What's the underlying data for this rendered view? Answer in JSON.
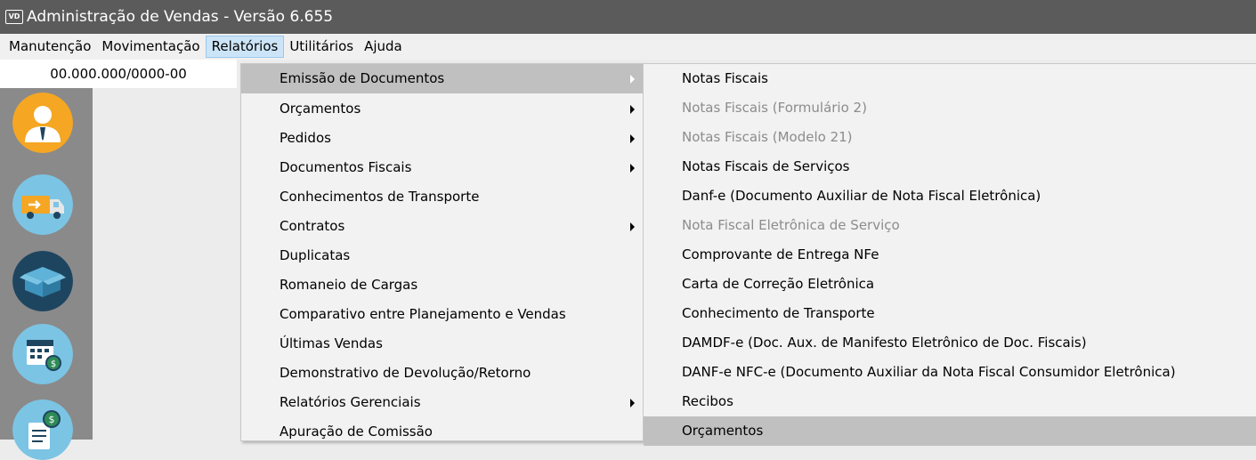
{
  "window": {
    "app_icon": "VD",
    "title": "Administração de Vendas - Versão 6.655"
  },
  "menubar": [
    {
      "label": "Manutenção"
    },
    {
      "label": "Movimentação"
    },
    {
      "label": "Relatórios",
      "active": true
    },
    {
      "label": "Utilitários"
    },
    {
      "label": "Ajuda"
    }
  ],
  "cnpj": "00.000.000/0000-00",
  "sidebar_icons": [
    "user-icon",
    "truck-icon",
    "box-icon",
    "calendar-money-icon",
    "document-money-icon"
  ],
  "relatorios_menu": [
    {
      "label": "Emissão de Documentos",
      "submenu": true,
      "highlighted": true
    },
    {
      "label": "Orçamentos",
      "submenu": true
    },
    {
      "label": "Pedidos",
      "submenu": true
    },
    {
      "label": "Documentos Fiscais",
      "submenu": true
    },
    {
      "label": "Conhecimentos de Transporte",
      "submenu": false
    },
    {
      "label": "Contratos",
      "submenu": true
    },
    {
      "label": "Duplicatas",
      "submenu": false
    },
    {
      "label": "Romaneio de Cargas",
      "submenu": false
    },
    {
      "label": "Comparativo entre Planejamento e Vendas",
      "submenu": false
    },
    {
      "label": "Últimas Vendas",
      "submenu": false
    },
    {
      "label": "Demonstrativo de Devolução/Retorno",
      "submenu": false
    },
    {
      "label": "Relatórios Gerenciais",
      "submenu": true
    },
    {
      "label": "Apuração de Comissão",
      "submenu": false
    }
  ],
  "emissao_submenu": [
    {
      "label": "Notas Fiscais",
      "enabled": true
    },
    {
      "label": "Notas Fiscais (Formulário 2)",
      "enabled": false
    },
    {
      "label": "Notas Fiscais (Modelo 21)",
      "enabled": false
    },
    {
      "label": "Notas Fiscais de Serviços",
      "enabled": true
    },
    {
      "label": "Danf-e (Documento Auxiliar de Nota Fiscal Eletrônica)",
      "enabled": true
    },
    {
      "label": "Nota Fiscal Eletrônica de Serviço",
      "enabled": false
    },
    {
      "label": "Comprovante de Entrega NFe",
      "enabled": true
    },
    {
      "label": "Carta de Correção Eletrônica",
      "enabled": true
    },
    {
      "label": "Conhecimento de Transporte",
      "enabled": true
    },
    {
      "label": "DAMDF-e (Doc. Aux. de Manifesto Eletrônico de Doc. Fiscais)",
      "enabled": true
    },
    {
      "label": "DANF-e NFC-e (Documento Auxiliar da Nota Fiscal Consumidor Eletrônica)",
      "enabled": true
    },
    {
      "label": "Recibos",
      "enabled": true
    },
    {
      "label": "Orçamentos",
      "enabled": true,
      "highlighted": true
    }
  ],
  "colors": {
    "titlebar": "#5b5b5b",
    "menu_highlight": "#c0c0c0",
    "disabled_text": "#8c8c8c",
    "icon_orange": "#f5a623",
    "icon_blue": "#7cc4e4",
    "icon_dark_blue": "#1e4560"
  }
}
